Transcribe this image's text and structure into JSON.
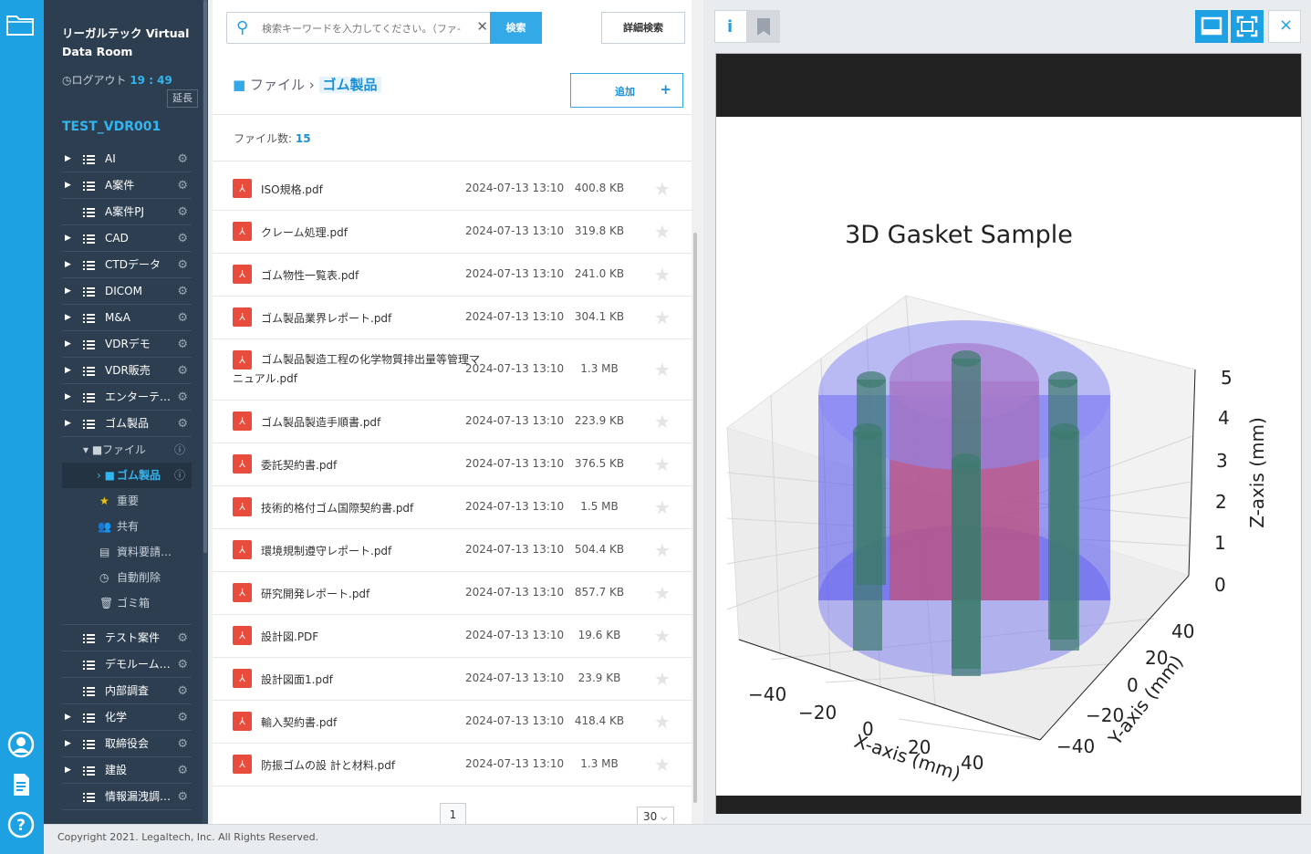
{
  "sidebar": {
    "brand": "リーガルテック Virtual Data Room",
    "logout_label": "ログアウト",
    "logout_time": "19 : 49",
    "extend_label": "延長",
    "room_name": "TEST_VDR001",
    "folders": [
      {
        "label": "AI",
        "caret": true
      },
      {
        "label": "A案件",
        "caret": true
      },
      {
        "label": "A案件PJ",
        "caret": false
      },
      {
        "label": "CAD",
        "caret": true
      },
      {
        "label": "CTDデータ",
        "caret": true
      },
      {
        "label": "DICOM",
        "caret": true
      },
      {
        "label": "M&A",
        "caret": true
      },
      {
        "label": "VDRデモ",
        "caret": true
      },
      {
        "label": "VDR販売",
        "caret": true
      },
      {
        "label": "エンターテ…",
        "caret": true
      },
      {
        "label": "ゴム製品",
        "caret": true
      }
    ],
    "subitems": {
      "files": "ファイル",
      "current": "ゴム製品",
      "important": "重要",
      "shared": "共有",
      "request": "資料要請…",
      "autodelete": "自動削除",
      "trash": "ゴミ箱"
    },
    "folders2": [
      {
        "label": "テスト案件",
        "caret": false
      },
      {
        "label": "デモルーム…",
        "caret": false
      },
      {
        "label": "内部調査",
        "caret": false
      },
      {
        "label": "化学",
        "caret": true
      },
      {
        "label": "取締役会",
        "caret": true
      },
      {
        "label": "建設",
        "caret": true
      },
      {
        "label": "情報漏洩調…",
        "caret": false
      }
    ]
  },
  "search": {
    "placeholder": "検索キーワードを入力してください。（ファ-",
    "button": "検索",
    "advanced": "詳細検索"
  },
  "breadcrumb": {
    "root": "ファイル",
    "current": "ゴム製品"
  },
  "add_button": "追加",
  "file_count_label": "ファイル数:",
  "file_count": "15",
  "files": [
    {
      "name": "ISO規格.pdf",
      "date": "2024-07-13 13:10",
      "size": "400.8 KB"
    },
    {
      "name": "クレーム処理.pdf",
      "date": "2024-07-13 13:10",
      "size": "319.8 KB"
    },
    {
      "name": "ゴム物性一覧表.pdf",
      "date": "2024-07-13 13:10",
      "size": "241.0 KB"
    },
    {
      "name": "ゴム製品業界レポート.pdf",
      "date": "2024-07-13 13:10",
      "size": "304.1 KB"
    },
    {
      "name": "ゴム製品製造工程の化学物質排出量等管理マニュアル.pdf",
      "date": "2024-07-13 13:10",
      "size": "1.3 MB"
    },
    {
      "name": "ゴム製品製造手順書.pdf",
      "date": "2024-07-13 13:10",
      "size": "223.9 KB"
    },
    {
      "name": "委託契約書.pdf",
      "date": "2024-07-13 13:10",
      "size": "376.5 KB"
    },
    {
      "name": "技術的格付ゴム国際契約書.pdf",
      "date": "2024-07-13 13:10",
      "size": "1.5 MB"
    },
    {
      "name": "環境規制遵守レポート.pdf",
      "date": "2024-07-13 13:10",
      "size": "504.4 KB"
    },
    {
      "name": "研究開発レポート.pdf",
      "date": "2024-07-13 13:10",
      "size": "857.7 KB"
    },
    {
      "name": "設計図.PDF",
      "date": "2024-07-13 13:10",
      "size": "19.6 KB"
    },
    {
      "name": "設計図面1.pdf",
      "date": "2024-07-13 13:10",
      "size": "23.9 KB"
    },
    {
      "name": "輸入契約書.pdf",
      "date": "2024-07-13 13:10",
      "size": "418.4 KB"
    },
    {
      "name": "防振ゴムの設 計と材料.pdf",
      "date": "2024-07-13 13:10",
      "size": "1.3 MB"
    }
  ],
  "pagination": {
    "page": "1",
    "per_page": "30"
  },
  "preview": {
    "info_label": "i",
    "close_label": "×",
    "title": "3D Gasket Sample",
    "x_axis_label": "X-axis (mm)",
    "y_axis_label": "Y-axis (mm)",
    "z_axis_label": "Z-axis (mm)",
    "x_ticks": [
      "−40",
      "−20",
      "0",
      "20",
      "40"
    ],
    "y_ticks": [
      "−40",
      "−20",
      "0",
      "20",
      "40"
    ],
    "z_ticks": [
      "0",
      "1",
      "2",
      "3",
      "4",
      "5"
    ]
  },
  "copyright": "Copyright 2021. Legaltech, Inc. All Rights Reserved.",
  "colors": {
    "accent": "#1da1e2",
    "sidebar": "#2c3e50",
    "pdf": "#e74c3c"
  }
}
